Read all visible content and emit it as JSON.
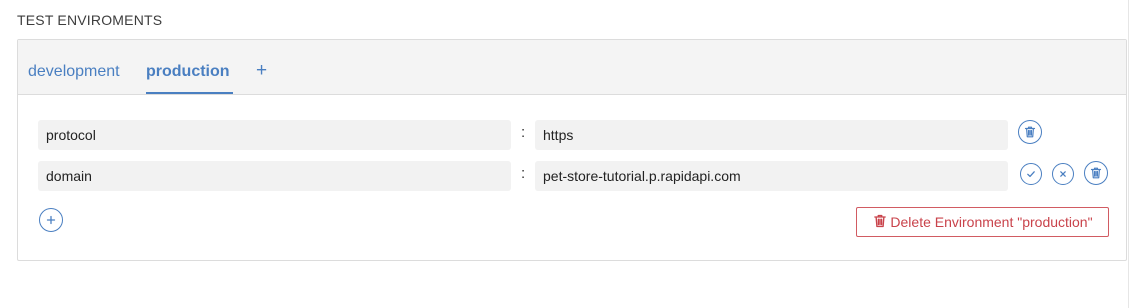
{
  "section": {
    "title": "TEST ENVIROMENTS"
  },
  "tabs": [
    {
      "label": "development",
      "active": false
    },
    {
      "label": "production",
      "active": true
    }
  ],
  "add_tab_label": "+",
  "variables": [
    {
      "key": "protocol",
      "value": "https",
      "separator": ":"
    },
    {
      "key": "domain",
      "value": "pet-store-tutorial.p.rapidapi.com",
      "separator": ":"
    }
  ],
  "delete_environment": {
    "label": "Delete Environment \"production\""
  },
  "icons": {
    "trash": "trash-icon",
    "check": "check-icon",
    "close": "close-icon",
    "plus": "plus-icon"
  },
  "colors": {
    "accent": "#4a7fc1",
    "danger": "#c9434b",
    "field_bg": "#f2f2f2",
    "tab_bar_bg": "#f4f4f4",
    "border": "#dcdcdc"
  }
}
